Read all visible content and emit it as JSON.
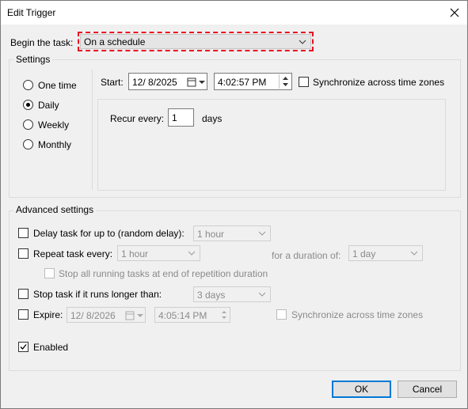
{
  "window": {
    "title": "Edit Trigger"
  },
  "begin_task": {
    "label": "Begin the task:",
    "value": "On a schedule"
  },
  "settings": {
    "legend": "Settings",
    "radios": [
      {
        "id": "one_time",
        "label": "One time",
        "selected": false
      },
      {
        "id": "daily",
        "label": "Daily",
        "selected": true
      },
      {
        "id": "weekly",
        "label": "Weekly",
        "selected": false
      },
      {
        "id": "monthly",
        "label": "Monthly",
        "selected": false
      }
    ],
    "start_label": "Start:",
    "start_date": "12/  8/2025",
    "start_time": "4:02:57 PM",
    "sync_label": "Synchronize across time zones",
    "recur_label": "Recur every:",
    "recur_value": "1",
    "recur_unit": "days"
  },
  "advanced": {
    "legend": "Advanced settings",
    "delay_label": "Delay task for up to (random delay):",
    "delay_value": "1 hour",
    "repeat_label": "Repeat task every:",
    "repeat_value": "1 hour",
    "duration_label": "for a duration of:",
    "duration_value": "1 day",
    "stop_all_label": "Stop all running tasks at end of repetition duration",
    "stop_longer_label": "Stop task if it runs longer than:",
    "stop_longer_value": "3 days",
    "expire_label": "Expire:",
    "expire_date": "12/  8/2026",
    "expire_time": "4:05:14 PM",
    "expire_sync_label": "Synchronize across time zones",
    "enabled_label": "Enabled"
  },
  "buttons": {
    "ok": "OK",
    "cancel": "Cancel"
  },
  "colors": {
    "highlight_border": "#e81123",
    "default_button_border": "#0078d7"
  }
}
